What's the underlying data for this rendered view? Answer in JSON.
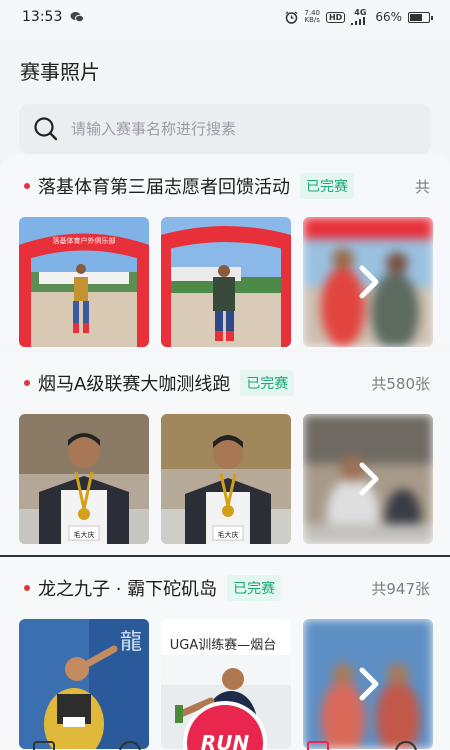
{
  "status": {
    "time": "13:53",
    "speed_value": "7.40",
    "speed_unit": "KB/s",
    "hd": "HD",
    "net": "4G",
    "battery": "66%",
    "battery_level": 0.66
  },
  "page": {
    "title": "赛事照片"
  },
  "search": {
    "placeholder": "请输入赛事名称进行搜素"
  },
  "events": [
    {
      "title": "落基体育第三届志愿者回馈活动",
      "status": "已完赛",
      "count": "共"
    },
    {
      "title": "烟马A级联赛大咖测线跑",
      "status": "已完赛",
      "count": "共580张"
    },
    {
      "title": "龙之九子 · 霸下砣矶岛",
      "status": "已完赛",
      "count": "共947张"
    }
  ],
  "photo_captions": {
    "e1p1_banner": "落基体育户外俱乐部",
    "e2_bib": "毛大庆",
    "e3_banner": "UGA训练赛—烟台"
  },
  "tabbar": {
    "center_label": "RUN"
  },
  "colors": {
    "accent": "#e8264e",
    "done": "#1aa67a",
    "dot": "#e2323c"
  }
}
